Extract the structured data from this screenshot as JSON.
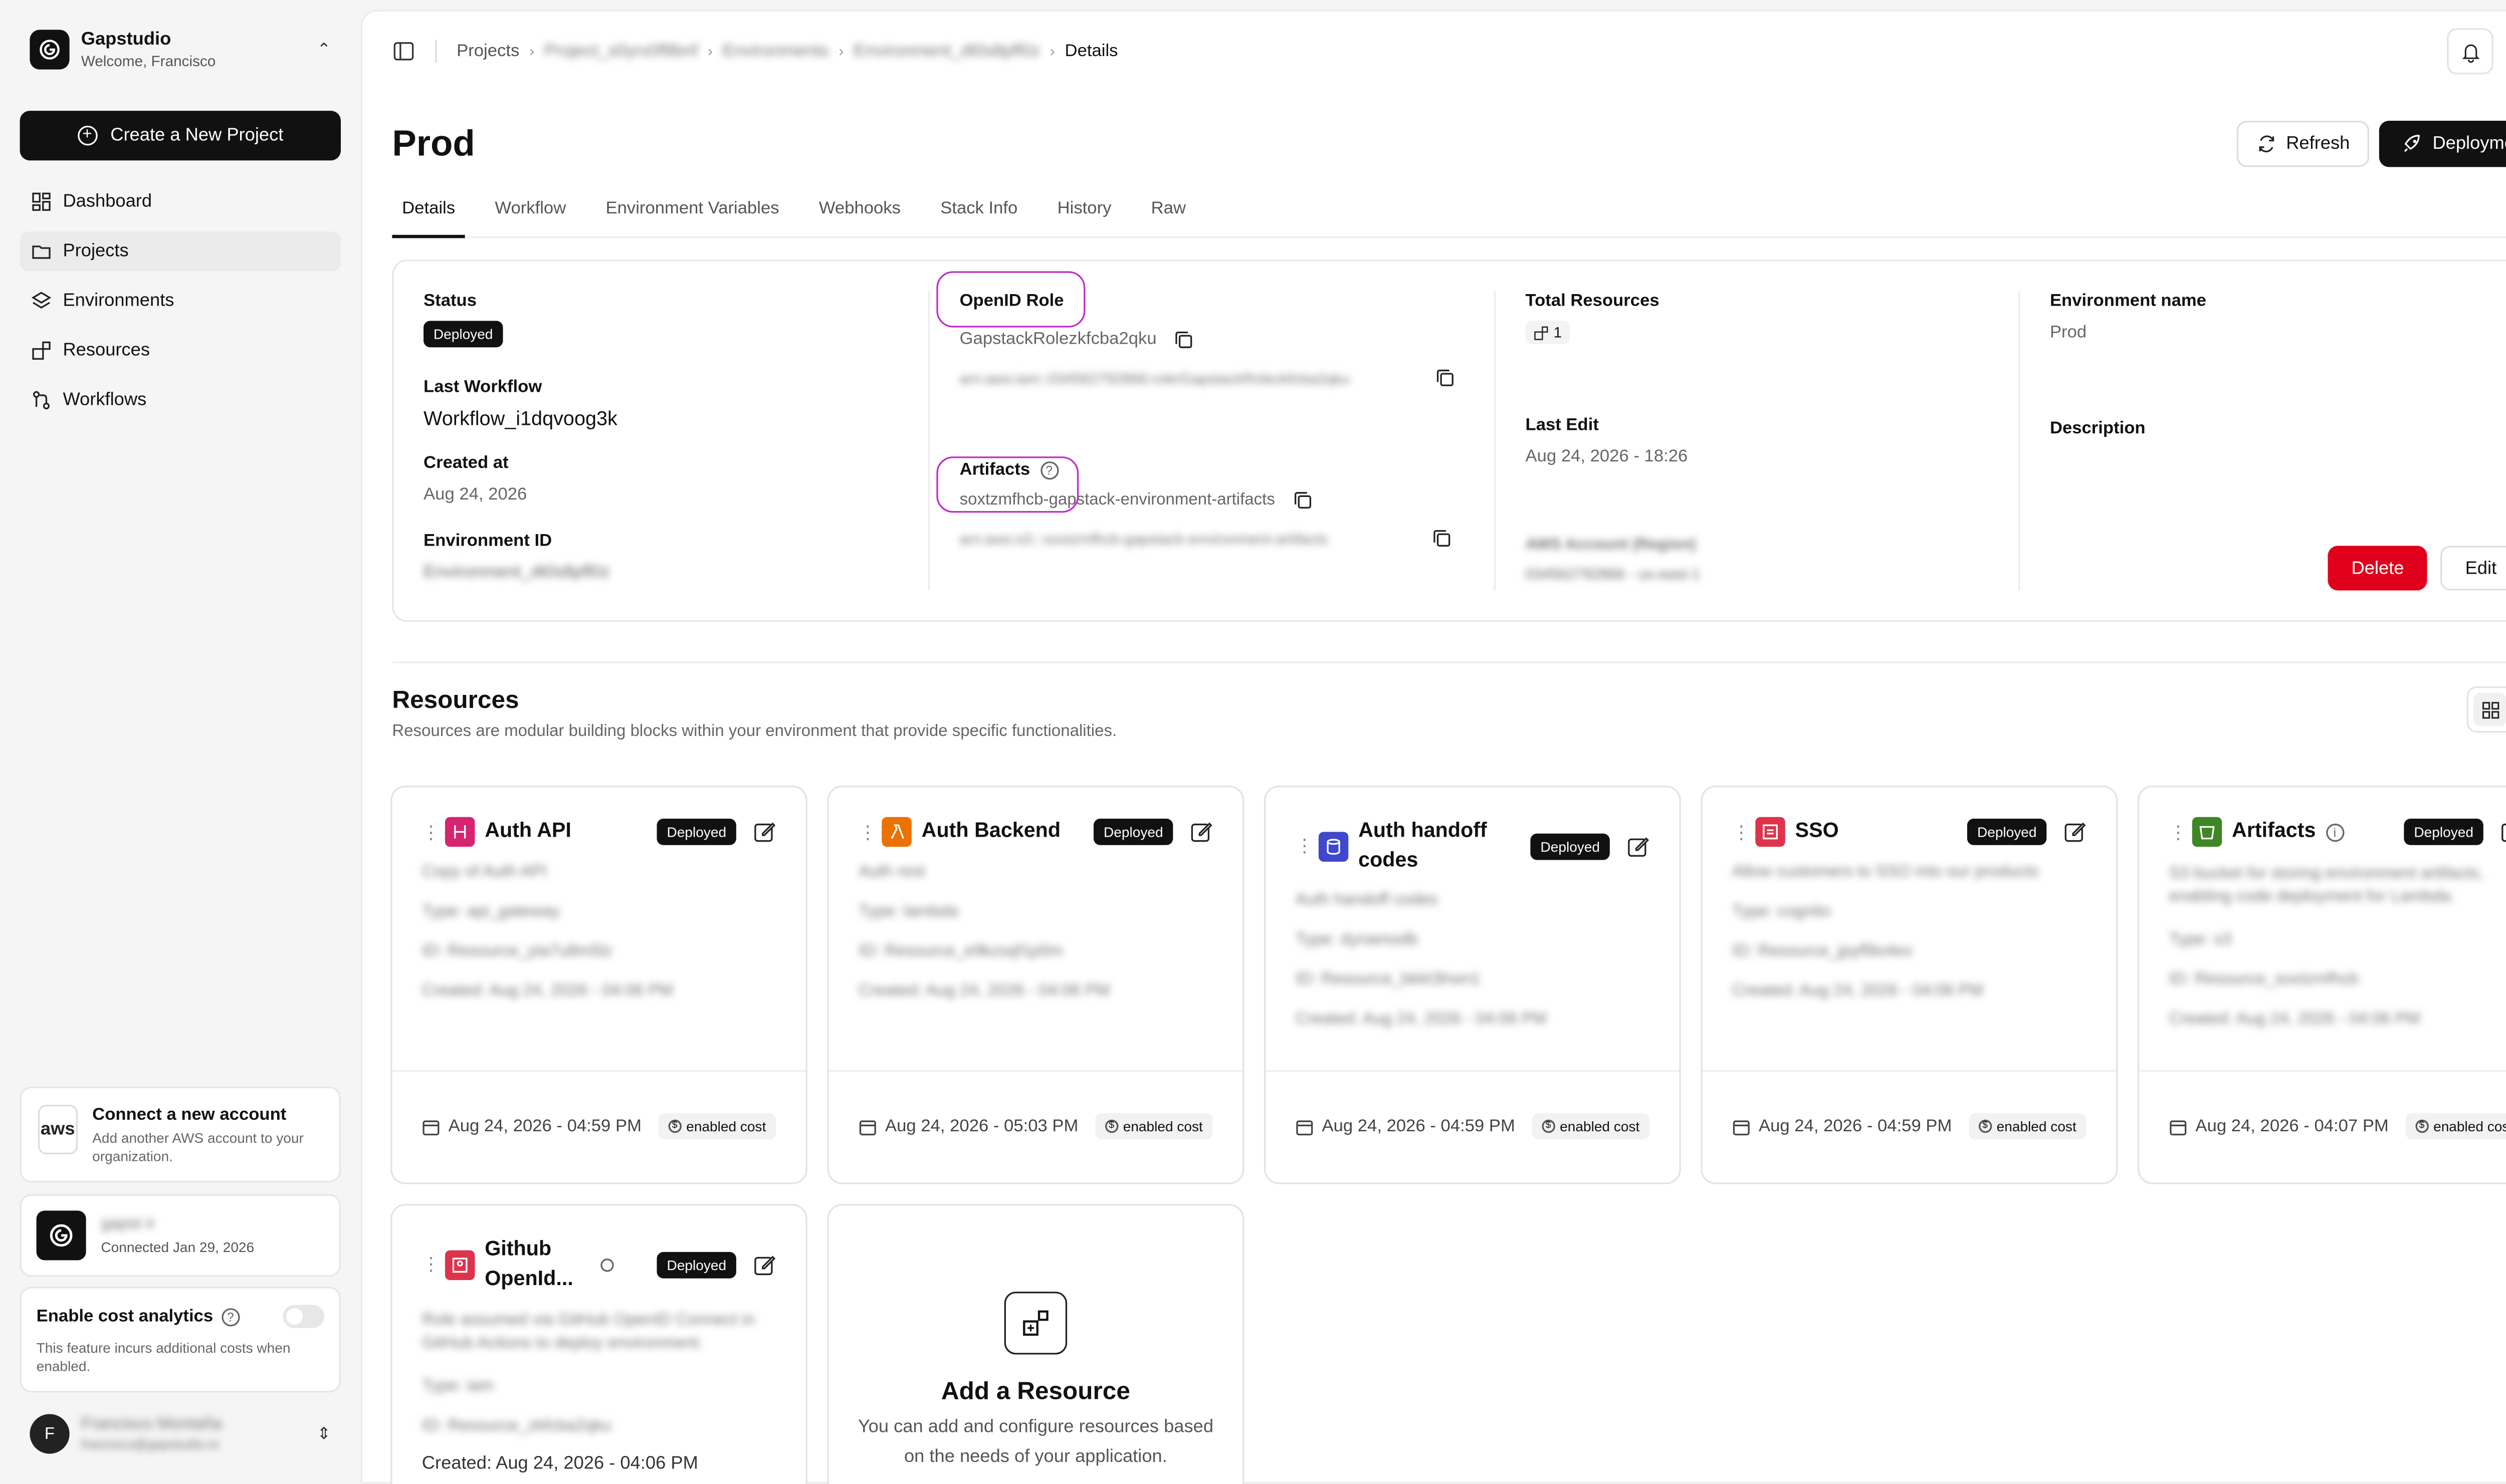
{
  "brand": {
    "name": "Gapstudio",
    "welcome": "Welcome, Francisco"
  },
  "sidebar": {
    "create_label": "Create a New Project",
    "items": [
      {
        "label": "Dashboard",
        "icon": "dashboard-icon"
      },
      {
        "label": "Projects",
        "icon": "folder-icon",
        "active": true
      },
      {
        "label": "Environments",
        "icon": "environments-icon"
      },
      {
        "label": "Resources",
        "icon": "resources-icon"
      },
      {
        "label": "Workflows",
        "icon": "workflow-icon"
      }
    ],
    "aws": {
      "logo": "aws",
      "title": "Connect a new account",
      "desc": "Add another AWS account to your organization."
    },
    "account": {
      "name": "gapst ir",
      "connected": "Connected Jan 29, 2026"
    },
    "cost": {
      "title": "Enable cost analytics",
      "desc": "This feature incurs additional costs when enabled."
    },
    "user": {
      "initial": "F",
      "name": "Francisco Montaña",
      "email": "francisco@gapstudio.io"
    }
  },
  "breadcrumb": {
    "items": [
      "Projects",
      "Project_s0yrx0f8bnf",
      "Environments",
      "Environment_dt0s8pfl0z",
      "Details"
    ]
  },
  "page": {
    "title": "Prod",
    "refresh_label": "Refresh",
    "deployment_label": "Deployment",
    "tabs": [
      "Details",
      "Workflow",
      "Environment Variables",
      "Webhooks",
      "Stack Info",
      "History",
      "Raw"
    ]
  },
  "details": {
    "status_label": "Status",
    "status_value": "Deployed",
    "last_workflow_label": "Last Workflow",
    "last_workflow_value": "Workflow_i1dqvoog3k",
    "created_label": "Created at",
    "created_value": "Aug 24, 2026",
    "env_id_label": "Environment ID",
    "env_id_value": "Environment_dt0s8pfl0z",
    "openid_label": "OpenID Role",
    "openid_value": "GapstackRolezkfcba2qku",
    "openid_arn": "arn:aws:iam::034562792866:role/GapstackRolezkfcba2qku",
    "artifacts_label": "Artifacts",
    "artifacts_value": "soxtzmfhcb-gapstack-environment-artifacts",
    "artifacts_arn": "arn:aws:s3:::soxtzmfhcb-gapstack-environment-artifacts",
    "total_resources_label": "Total Resources",
    "total_resources_value": "1",
    "last_edit_label": "Last Edit",
    "last_edit_value": "Aug 24, 2026 - 18:26",
    "aws_account_label": "AWS Account (Region)",
    "aws_account_value": "034562792866 - us-east-1",
    "env_name_label": "Environment name",
    "env_name_value": "Prod",
    "description_label": "Description",
    "delete_label": "Delete",
    "edit_label": "Edit"
  },
  "resources": {
    "title": "Resources",
    "subtitle": "Resources are modular building blocks within your environment that provide specific functionalities.",
    "type_label": "Type:",
    "cost_label": "enabled cost",
    "items": [
      {
        "name": "Auth API",
        "status": "Deployed",
        "color": "#d6246e",
        "desc": "Copy of Auth API",
        "type": "api_gateway",
        "id": "ID: Resource_yta7u8m5lz",
        "created": "Created: Aug 24, 2026 - 04:06 PM",
        "date": "Aug 24, 2026 - 04:59 PM"
      },
      {
        "name": "Auth Backend",
        "status": "Deployed",
        "color": "#ed7100",
        "desc": "Auth rest",
        "type": "lambda",
        "id": "ID: Resource_e9kzsqf1p0m",
        "created": "Created: Aug 24, 2026 - 04:06 PM",
        "date": "Aug 24, 2026 - 05:03 PM"
      },
      {
        "name": "Auth handoff codes",
        "status": "Deployed",
        "color": "#3f48cc",
        "desc": "Auth handoff codes",
        "type": "dynamodb",
        "id": "ID: Resource_bkkt3lrwn1",
        "created": "Created: Aug 24, 2026 - 04:06 PM",
        "date": "Aug 24, 2026 - 04:59 PM"
      },
      {
        "name": "SSO",
        "status": "Deployed",
        "color": "#dd344c",
        "desc": "Allow customers to SSO into our products",
        "type": "cognito",
        "id": "ID: Resource_jpyfl9o4ex",
        "created": "Created: Aug 24, 2026 - 04:06 PM",
        "date": "Aug 24, 2026 - 04:59 PM"
      },
      {
        "name": "Artifacts",
        "status": "Deployed",
        "color": "#3f8624",
        "desc": "S3 bucket for storing environment artifacts, enabling code deployment for Lambda.",
        "type": "s3",
        "id": "ID: Resource_soxtzmfhcb",
        "created": "Created: Aug 24, 2026 - 04:06 PM",
        "date": "Aug 24, 2026 - 04:07 PM"
      },
      {
        "name": "Github OpenId...",
        "status": "Deployed",
        "color": "#dd344c",
        "desc": "Role assumed via GitHub OpenID Connect in GitHub Actions to deploy environment.",
        "type": "iam",
        "id": "ID: Resource_zkfcba2qku",
        "created": "Created: Aug 24, 2026 - 04:06 PM",
        "date": ""
      }
    ],
    "add": {
      "title": "Add a Resource",
      "desc": "You can add and configure resources based on the needs of your application."
    }
  },
  "colors": {
    "accent_dark": "#111111",
    "danger": "#e0001b",
    "annotation": "#c02cc8"
  }
}
